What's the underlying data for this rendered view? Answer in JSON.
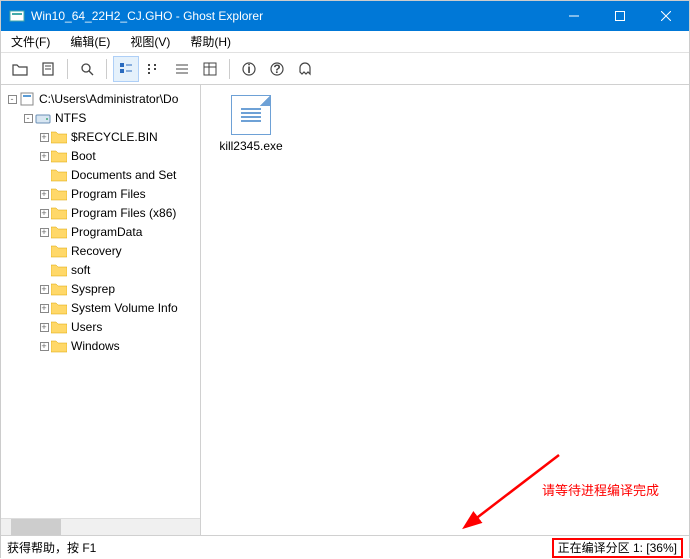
{
  "title": "Win10_64_22H2_CJ.GHO - Ghost Explorer",
  "menu": {
    "file": "文件(F)",
    "edit": "编辑(E)",
    "view": "视图(V)",
    "help": "帮助(H)"
  },
  "tree": {
    "root": "C:\\Users\\Administrator\\Do",
    "drive": "NTFS",
    "items": [
      {
        "label": "$RECYCLE.BIN",
        "exp": true
      },
      {
        "label": "Boot",
        "exp": true
      },
      {
        "label": "Documents and Set",
        "exp": false
      },
      {
        "label": "Program Files",
        "exp": true
      },
      {
        "label": "Program Files (x86)",
        "exp": true
      },
      {
        "label": "ProgramData",
        "exp": true
      },
      {
        "label": "Recovery",
        "exp": false
      },
      {
        "label": "soft",
        "exp": false
      },
      {
        "label": "Sysprep",
        "exp": true
      },
      {
        "label": "System Volume Info",
        "exp": true
      },
      {
        "label": "Users",
        "exp": true
      },
      {
        "label": "Windows",
        "exp": true
      }
    ]
  },
  "file": {
    "name": "kill2345.exe"
  },
  "hint": "请等待进程编译完成",
  "status": {
    "left": "获得帮助，按 F1",
    "right": "正在编译分区 1: [36%]"
  }
}
